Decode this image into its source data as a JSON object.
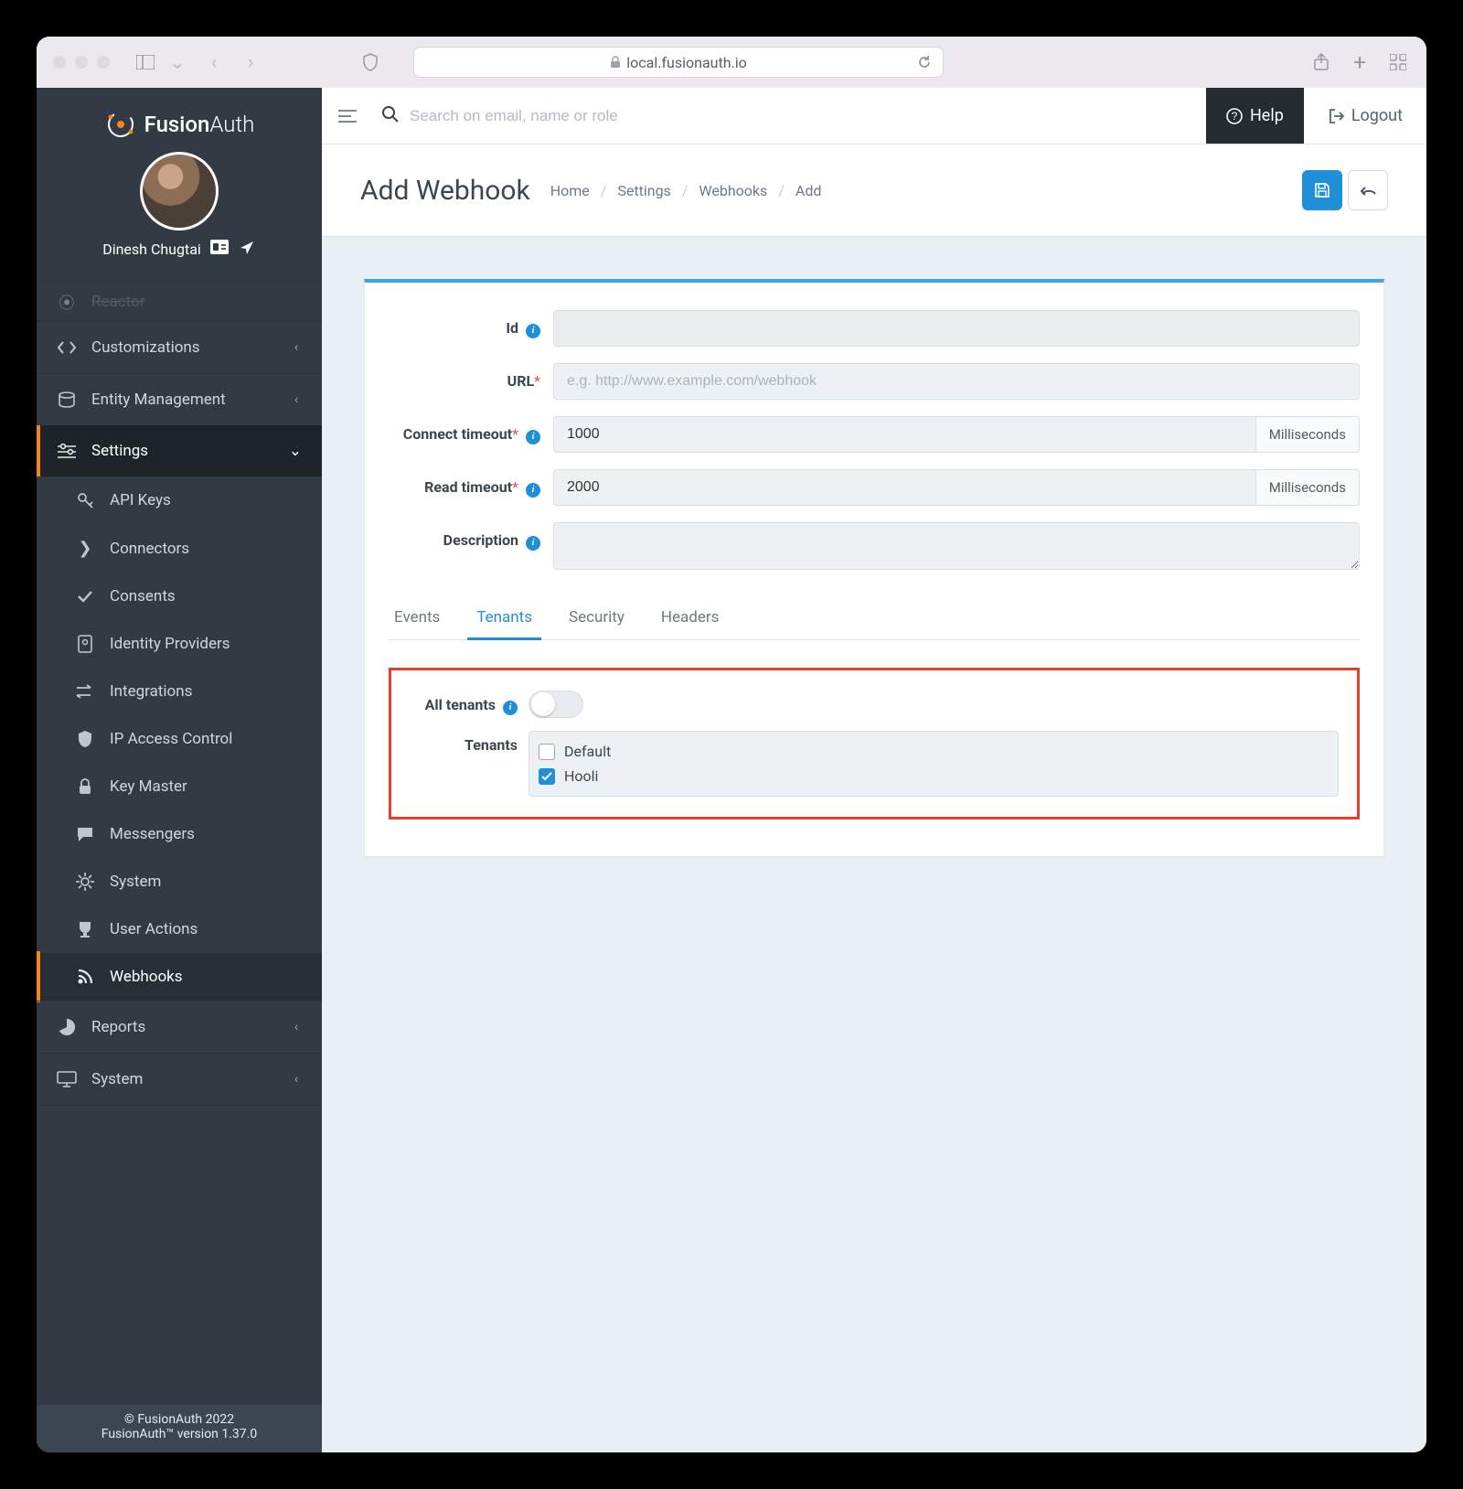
{
  "browser": {
    "url": "local.fusionauth.io"
  },
  "brand": {
    "name_a": "Fusion",
    "name_b": "Auth"
  },
  "user": {
    "name": "Dinesh Chugtai"
  },
  "topbar": {
    "search_placeholder": "Search on email, name or role",
    "help": "Help",
    "logout": "Logout"
  },
  "page": {
    "title": "Add Webhook",
    "breadcrumbs": [
      "Home",
      "Settings",
      "Webhooks",
      "Add"
    ]
  },
  "form": {
    "id_label": "Id",
    "url_label": "URL",
    "url_placeholder": "e.g. http://www.example.com/webhook",
    "connect_label": "Connect timeout",
    "connect_value": "1000",
    "read_label": "Read timeout",
    "read_value": "2000",
    "ms": "Milliseconds",
    "desc_label": "Description"
  },
  "tabs": {
    "events": "Events",
    "tenants": "Tenants",
    "security": "Security",
    "headers": "Headers"
  },
  "tenant_panel": {
    "all_tenants": "All tenants",
    "tenants_label": "Tenants",
    "options": {
      "default": "Default",
      "hooli": "Hooli"
    }
  },
  "nav": {
    "reactor": "Reactor",
    "customizations": "Customizations",
    "entity": "Entity Management",
    "settings": "Settings",
    "api_keys": "API Keys",
    "connectors": "Connectors",
    "consents": "Consents",
    "identity": "Identity Providers",
    "integrations": "Integrations",
    "ip_access": "IP Access Control",
    "key_master": "Key Master",
    "messengers": "Messengers",
    "system": "System",
    "user_actions": "User Actions",
    "webhooks": "Webhooks",
    "reports": "Reports",
    "system2": "System"
  },
  "footer": {
    "copy": "© FusionAuth 2022",
    "ver": "FusionAuth™ version 1.37.0"
  }
}
